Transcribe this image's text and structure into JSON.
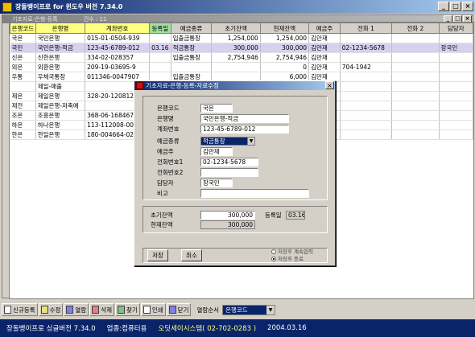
{
  "app": {
    "title": "장돌뱅이프로 for 윈도우 버전 7.34.0"
  },
  "inner": {
    "title": "기초자료-은행-등록",
    "count": "건수 : 11"
  },
  "grid": {
    "columns": [
      "은행코드",
      "은행명",
      "계좌번호",
      "등록일",
      "예금종류",
      "초기잔액",
      "현재잔액",
      "예금주",
      "전화 1",
      "전화 2",
      "담당자"
    ],
    "rows": [
      [
        "국은",
        "국민은행",
        "015-01-0504-939",
        "",
        "입출금통장",
        "1,254,000",
        "1,254,000",
        "김만재",
        "",
        "",
        ""
      ],
      [
        "국민",
        "국민은행-적금",
        "123-45-6789-012",
        "03.16",
        "적금통장",
        "300,000",
        "300,000",
        "김만재",
        "02-1234-5678",
        "",
        "장국민"
      ],
      [
        "신은",
        "신한은행",
        "334-02-028357",
        "",
        "입출금통장",
        "2,754,946",
        "2,754,946",
        "김만재",
        "",
        "",
        ""
      ],
      [
        "외은",
        "외환은행",
        "209-19-03695-9",
        "",
        "",
        "",
        "0",
        "김만재",
        "704-1942",
        "",
        ""
      ],
      [
        "우통",
        "우체국통장",
        "011346-0047907",
        "",
        "입출금통장",
        "",
        "6,000",
        "김만재",
        "",
        "",
        ""
      ],
      [
        "",
        "제일-매출",
        "",
        "",
        "",
        "",
        "",
        "",
        "",
        "",
        ""
      ],
      [
        "제은",
        "제일은행",
        "328-20-120812",
        "",
        "",
        "",
        "",
        "",
        "",
        "",
        ""
      ],
      [
        "제전",
        "제일은행-저축예",
        "",
        "",
        "",
        "",
        "",
        "",
        "",
        "",
        ""
      ],
      [
        "조은",
        "조흥은행",
        "368-06-168467",
        "",
        "",
        "",
        "",
        "",
        "",
        "",
        ""
      ],
      [
        "하은",
        "하나은행",
        "113-112008-00107",
        "",
        "",
        "",
        "",
        "",
        "",
        "",
        ""
      ],
      [
        "한은",
        "한일은행",
        "180-004664-02-001",
        "",
        "",
        "",
        "",
        "",
        "",
        "",
        ""
      ]
    ]
  },
  "dialog": {
    "title": "기초자료-은행-등록-자료수정",
    "labels": {
      "code": "은행코드",
      "name": "은행명",
      "account": "계좌번호",
      "type": "예금종류",
      "owner": "예금주",
      "phone1": "전화번호1",
      "phone2": "전화번호2",
      "manager": "담당자",
      "memo": "비고",
      "initial": "초기잔액",
      "regdate": "등록일",
      "current": "현재잔액"
    },
    "values": {
      "code": "국은",
      "name": "국민은행-적금",
      "account": "123-45-6789-012",
      "type": "적금통장",
      "owner": "김만재",
      "phone1": "02-1234-5678",
      "phone2": "",
      "manager": "장국민",
      "memo": "",
      "initial": "300,000",
      "regdate": "03.16",
      "current": "300,000"
    },
    "save_label": "저장",
    "cancel_label": "취소",
    "radio1": "저장후 계속입력",
    "radio2": "저장후 종료"
  },
  "toolbar": {
    "buttons": [
      "신규등록",
      "수정",
      "열람",
      "삭제",
      "찾기",
      "인쇄",
      "닫기"
    ],
    "sort_label": "열람순서",
    "sort_value": "은행코드"
  },
  "status": {
    "edition": "장돌뱅이프로 싱글버전 7.34.0",
    "industry": "업종:컴퓨터용",
    "company": "오딧세이시스템( 02-702-0283 )",
    "date": "2004.03.16"
  }
}
